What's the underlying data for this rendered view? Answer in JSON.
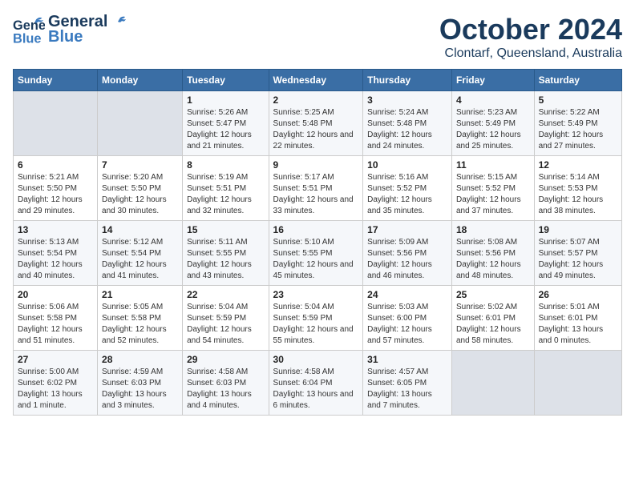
{
  "header": {
    "logo_general": "General",
    "logo_blue": "Blue",
    "title": "October 2024",
    "subtitle": "Clontarf, Queensland, Australia"
  },
  "calendar": {
    "days_of_week": [
      "Sunday",
      "Monday",
      "Tuesday",
      "Wednesday",
      "Thursday",
      "Friday",
      "Saturday"
    ],
    "weeks": [
      [
        {
          "day": "",
          "empty": true
        },
        {
          "day": "",
          "empty": true
        },
        {
          "day": "1",
          "sunrise": "Sunrise: 5:26 AM",
          "sunset": "Sunset: 5:47 PM",
          "daylight": "Daylight: 12 hours and 21 minutes."
        },
        {
          "day": "2",
          "sunrise": "Sunrise: 5:25 AM",
          "sunset": "Sunset: 5:48 PM",
          "daylight": "Daylight: 12 hours and 22 minutes."
        },
        {
          "day": "3",
          "sunrise": "Sunrise: 5:24 AM",
          "sunset": "Sunset: 5:48 PM",
          "daylight": "Daylight: 12 hours and 24 minutes."
        },
        {
          "day": "4",
          "sunrise": "Sunrise: 5:23 AM",
          "sunset": "Sunset: 5:49 PM",
          "daylight": "Daylight: 12 hours and 25 minutes."
        },
        {
          "day": "5",
          "sunrise": "Sunrise: 5:22 AM",
          "sunset": "Sunset: 5:49 PM",
          "daylight": "Daylight: 12 hours and 27 minutes."
        }
      ],
      [
        {
          "day": "6",
          "sunrise": "Sunrise: 5:21 AM",
          "sunset": "Sunset: 5:50 PM",
          "daylight": "Daylight: 12 hours and 29 minutes."
        },
        {
          "day": "7",
          "sunrise": "Sunrise: 5:20 AM",
          "sunset": "Sunset: 5:50 PM",
          "daylight": "Daylight: 12 hours and 30 minutes."
        },
        {
          "day": "8",
          "sunrise": "Sunrise: 5:19 AM",
          "sunset": "Sunset: 5:51 PM",
          "daylight": "Daylight: 12 hours and 32 minutes."
        },
        {
          "day": "9",
          "sunrise": "Sunrise: 5:17 AM",
          "sunset": "Sunset: 5:51 PM",
          "daylight": "Daylight: 12 hours and 33 minutes."
        },
        {
          "day": "10",
          "sunrise": "Sunrise: 5:16 AM",
          "sunset": "Sunset: 5:52 PM",
          "daylight": "Daylight: 12 hours and 35 minutes."
        },
        {
          "day": "11",
          "sunrise": "Sunrise: 5:15 AM",
          "sunset": "Sunset: 5:52 PM",
          "daylight": "Daylight: 12 hours and 37 minutes."
        },
        {
          "day": "12",
          "sunrise": "Sunrise: 5:14 AM",
          "sunset": "Sunset: 5:53 PM",
          "daylight": "Daylight: 12 hours and 38 minutes."
        }
      ],
      [
        {
          "day": "13",
          "sunrise": "Sunrise: 5:13 AM",
          "sunset": "Sunset: 5:54 PM",
          "daylight": "Daylight: 12 hours and 40 minutes."
        },
        {
          "day": "14",
          "sunrise": "Sunrise: 5:12 AM",
          "sunset": "Sunset: 5:54 PM",
          "daylight": "Daylight: 12 hours and 41 minutes."
        },
        {
          "day": "15",
          "sunrise": "Sunrise: 5:11 AM",
          "sunset": "Sunset: 5:55 PM",
          "daylight": "Daylight: 12 hours and 43 minutes."
        },
        {
          "day": "16",
          "sunrise": "Sunrise: 5:10 AM",
          "sunset": "Sunset: 5:55 PM",
          "daylight": "Daylight: 12 hours and 45 minutes."
        },
        {
          "day": "17",
          "sunrise": "Sunrise: 5:09 AM",
          "sunset": "Sunset: 5:56 PM",
          "daylight": "Daylight: 12 hours and 46 minutes."
        },
        {
          "day": "18",
          "sunrise": "Sunrise: 5:08 AM",
          "sunset": "Sunset: 5:56 PM",
          "daylight": "Daylight: 12 hours and 48 minutes."
        },
        {
          "day": "19",
          "sunrise": "Sunrise: 5:07 AM",
          "sunset": "Sunset: 5:57 PM",
          "daylight": "Daylight: 12 hours and 49 minutes."
        }
      ],
      [
        {
          "day": "20",
          "sunrise": "Sunrise: 5:06 AM",
          "sunset": "Sunset: 5:58 PM",
          "daylight": "Daylight: 12 hours and 51 minutes."
        },
        {
          "day": "21",
          "sunrise": "Sunrise: 5:05 AM",
          "sunset": "Sunset: 5:58 PM",
          "daylight": "Daylight: 12 hours and 52 minutes."
        },
        {
          "day": "22",
          "sunrise": "Sunrise: 5:04 AM",
          "sunset": "Sunset: 5:59 PM",
          "daylight": "Daylight: 12 hours and 54 minutes."
        },
        {
          "day": "23",
          "sunrise": "Sunrise: 5:04 AM",
          "sunset": "Sunset: 5:59 PM",
          "daylight": "Daylight: 12 hours and 55 minutes."
        },
        {
          "day": "24",
          "sunrise": "Sunrise: 5:03 AM",
          "sunset": "Sunset: 6:00 PM",
          "daylight": "Daylight: 12 hours and 57 minutes."
        },
        {
          "day": "25",
          "sunrise": "Sunrise: 5:02 AM",
          "sunset": "Sunset: 6:01 PM",
          "daylight": "Daylight: 12 hours and 58 minutes."
        },
        {
          "day": "26",
          "sunrise": "Sunrise: 5:01 AM",
          "sunset": "Sunset: 6:01 PM",
          "daylight": "Daylight: 13 hours and 0 minutes."
        }
      ],
      [
        {
          "day": "27",
          "sunrise": "Sunrise: 5:00 AM",
          "sunset": "Sunset: 6:02 PM",
          "daylight": "Daylight: 13 hours and 1 minute."
        },
        {
          "day": "28",
          "sunrise": "Sunrise: 4:59 AM",
          "sunset": "Sunset: 6:03 PM",
          "daylight": "Daylight: 13 hours and 3 minutes."
        },
        {
          "day": "29",
          "sunrise": "Sunrise: 4:58 AM",
          "sunset": "Sunset: 6:03 PM",
          "daylight": "Daylight: 13 hours and 4 minutes."
        },
        {
          "day": "30",
          "sunrise": "Sunrise: 4:58 AM",
          "sunset": "Sunset: 6:04 PM",
          "daylight": "Daylight: 13 hours and 6 minutes."
        },
        {
          "day": "31",
          "sunrise": "Sunrise: 4:57 AM",
          "sunset": "Sunset: 6:05 PM",
          "daylight": "Daylight: 13 hours and 7 minutes."
        },
        {
          "day": "",
          "empty": true
        },
        {
          "day": "",
          "empty": true
        }
      ]
    ]
  }
}
